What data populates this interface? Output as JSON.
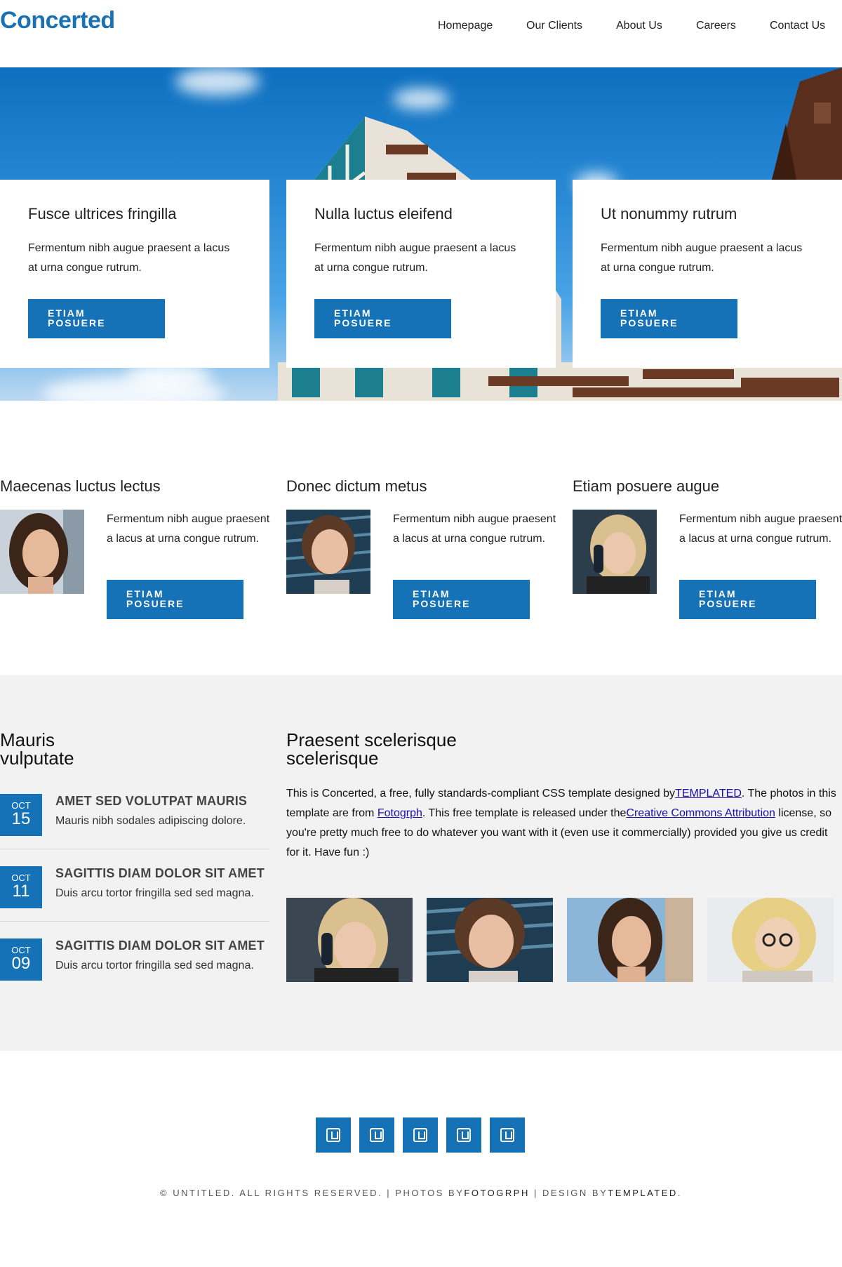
{
  "header": {
    "logo": "Concerted",
    "nav": [
      "Homepage",
      "Our Clients",
      "About Us",
      "Careers",
      "Contact Us"
    ]
  },
  "hero": {
    "cards": [
      {
        "title": "Fusce ultrices fringilla",
        "text": "Fermentum nibh augue praesent a lacus at urna congue rutrum.",
        "button": "ETIAM POSUERE"
      },
      {
        "title": "Nulla luctus eleifend",
        "text": "Fermentum nibh augue praesent a lacus at urna congue rutrum.",
        "button": "ETIAM POSUERE"
      },
      {
        "title": "Ut nonummy rutrum",
        "text": "Fermentum nibh augue praesent a lacus at urna congue rutrum.",
        "button": "ETIAM POSUERE"
      }
    ]
  },
  "features": [
    {
      "title": "Maecenas luctus lectus",
      "text": "Fermentum nibh augue praesent a lacus at urna congue rutrum.",
      "button": "ETIAM POSUERE"
    },
    {
      "title": "Donec dictum metus",
      "text": "Fermentum nibh augue praesent a lacus at urna congue rutrum.",
      "button": "ETIAM POSUERE"
    },
    {
      "title": "Etiam posuere augue",
      "text": "Fermentum nibh augue praesent a lacus at urna congue rutrum.",
      "button": "ETIAM POSUERE"
    }
  ],
  "events": {
    "title_line1": "Mauris",
    "title_line2": "vulputate",
    "items": [
      {
        "month": "OCT",
        "day": "15",
        "title": "AMET SED VOLUTPAT MAURIS",
        "text": "Mauris nibh sodales adipiscing dolore."
      },
      {
        "month": "OCT",
        "day": "11",
        "title": "SAGITTIS DIAM DOLOR SIT AMET",
        "text": "Duis arcu tortor fringilla sed sed magna."
      },
      {
        "month": "OCT",
        "day": "09",
        "title": "SAGITTIS DIAM DOLOR SIT AMET",
        "text": "Duis arcu tortor fringilla sed sed magna."
      }
    ]
  },
  "about": {
    "title_line1": "Praesent scelerisque",
    "title_line2": "scelerisque",
    "text_1": "This is Concerted, a free, fully standards-compliant CSS template designed by",
    "link_1": "TEMPLATED",
    "text_2": ". The photos in this template are from ",
    "link_2": "Fotogrph",
    "text_3": ". This free template is released under the",
    "link_3": "Creative Commons Attribution",
    "text_4": " license, so you're pretty much free to do whatever you want with it (even use it commercially) provided you give us credit for it. Have fun :)"
  },
  "footer": {
    "social_icons": [
      "social-icon-1",
      "social-icon-2",
      "social-icon-3",
      "social-icon-4",
      "social-icon-5"
    ],
    "copy_1": "© UNTITLED. ALL RIGHTS RESERVED. | PHOTOS BY",
    "copy_photos": "FOTOGRPH",
    "copy_2": " | DESIGN BY",
    "copy_design": "TEMPLATED",
    "copy_3": "."
  },
  "colors": {
    "accent": "#1572b6",
    "gray_bg": "#f2f2f2"
  }
}
